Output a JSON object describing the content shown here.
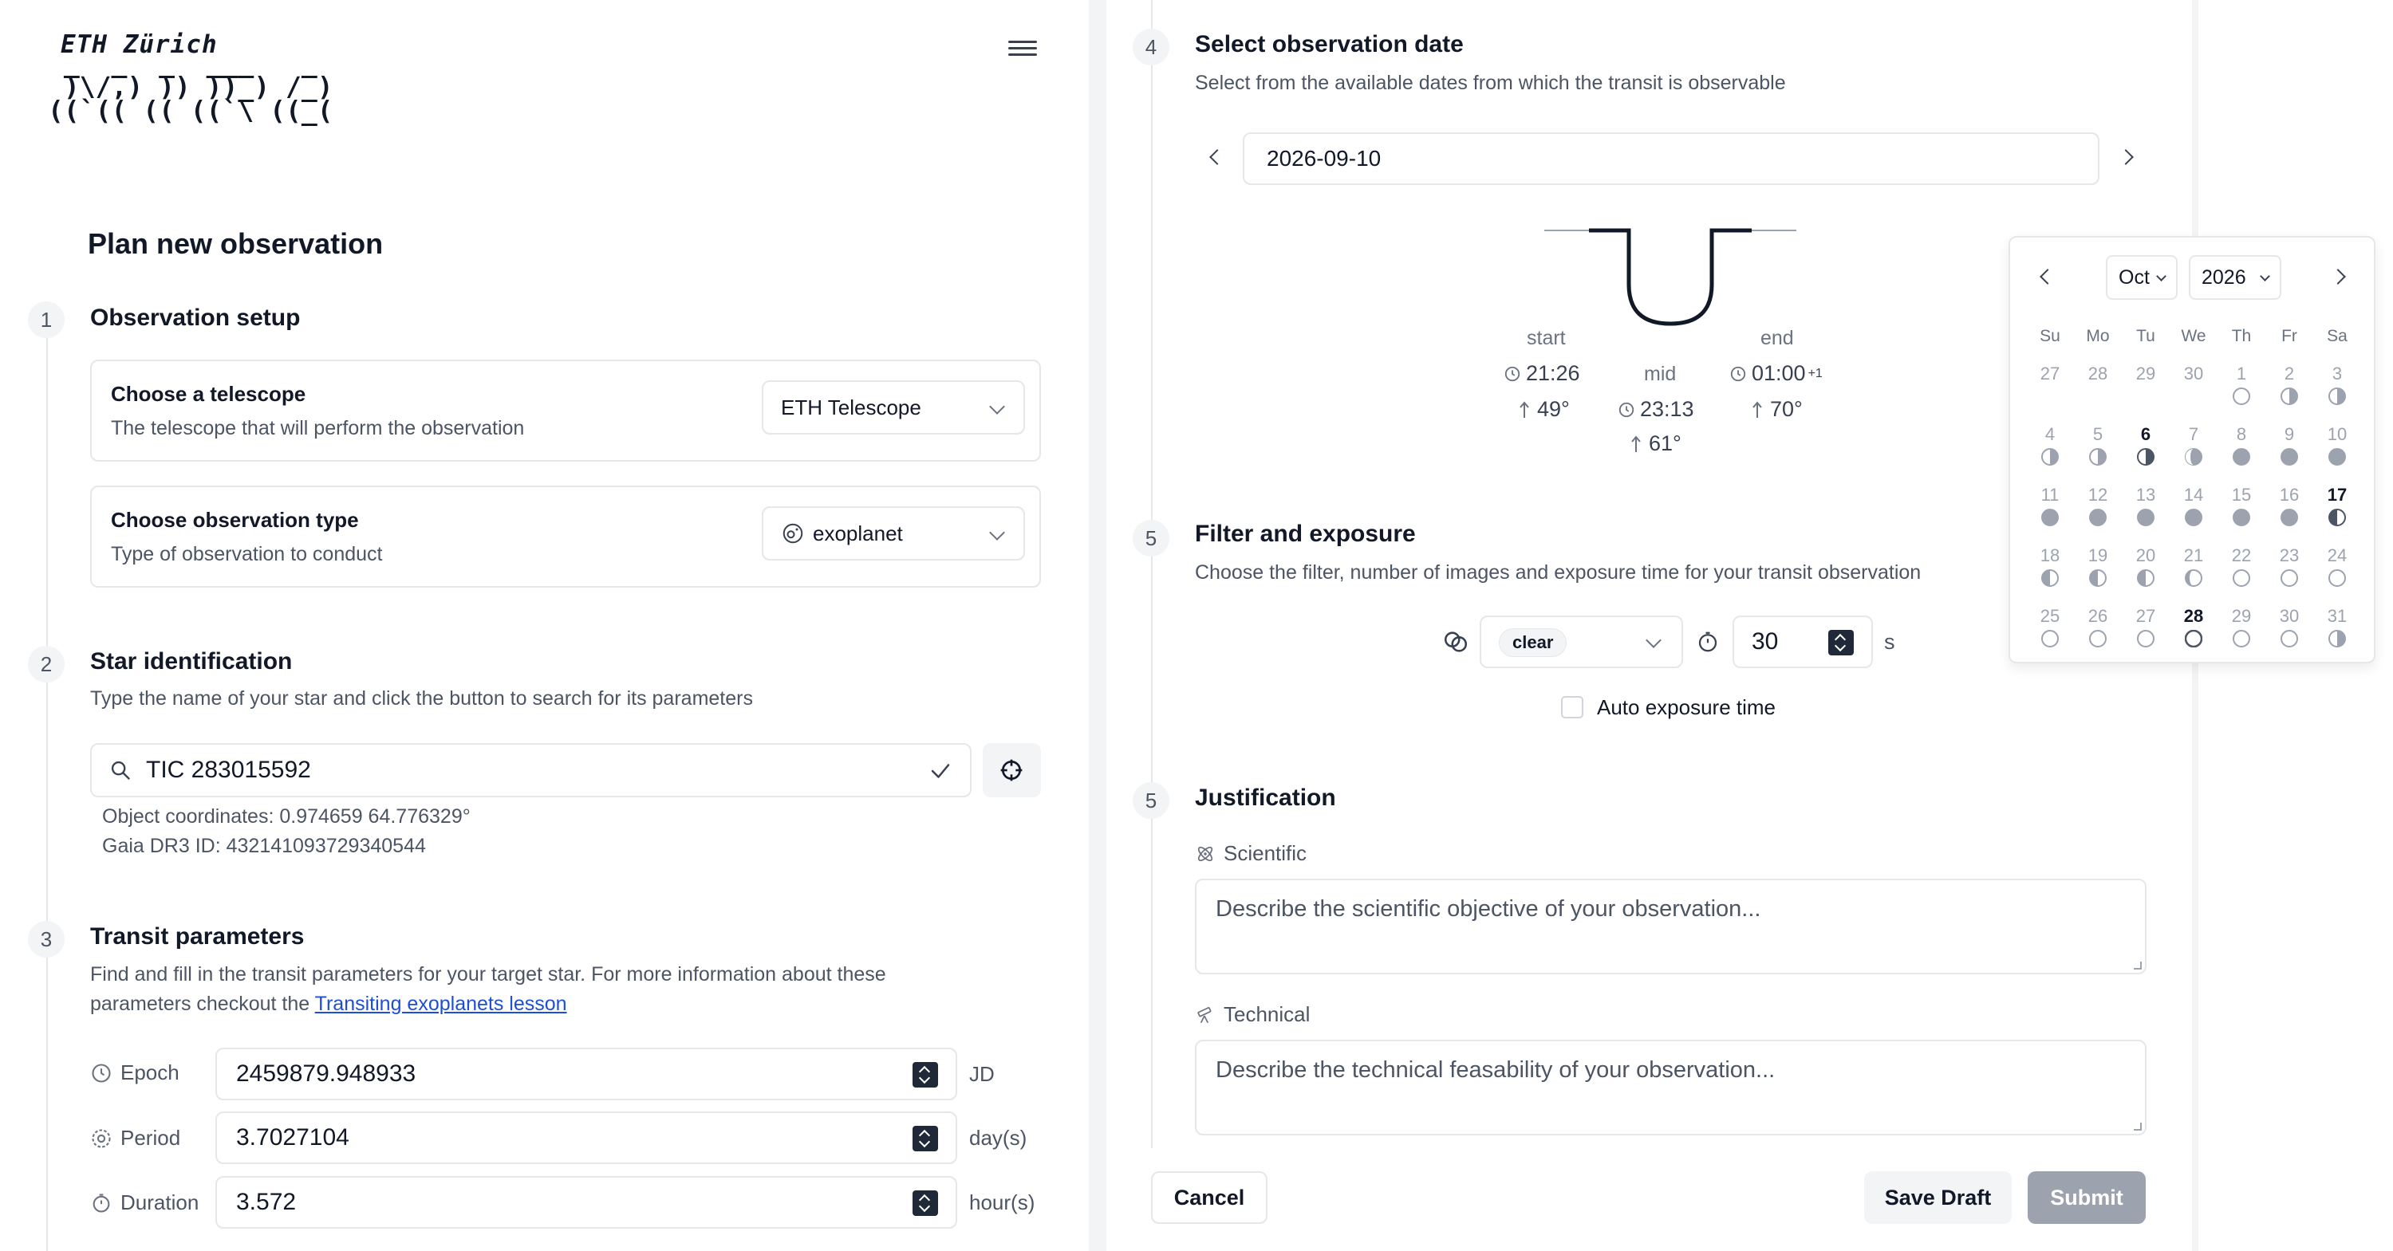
{
  "header": {
    "logo_title": "ETH Zürich",
    "logo_art_line1": " ̅)\\/̅,) ̅)) ̅)̅)̅_) /̅_)",
    "logo_art_line2": "((`(( (( ((`\\ ((_("
  },
  "page_title": "Plan new observation",
  "steps": {
    "s1": {
      "num": "1",
      "title": "Observation setup"
    },
    "s2": {
      "num": "2",
      "title": "Star identification",
      "desc": "Type the name of your star and click the button to search for its parameters"
    },
    "s3": {
      "num": "3",
      "title": "Transit parameters",
      "desc_part1": "Find and fill in the transit parameters for your target star. For more information about these",
      "desc_part2": "parameters checkout the ",
      "link": "Transiting exoplanets lesson"
    },
    "s4": {
      "num": "4",
      "title": "Select observation date",
      "desc": "Select from the available dates from which the transit is observable"
    },
    "s5": {
      "num": "5",
      "title": "Filter and exposure",
      "desc": "Choose the filter, number of images and exposure time for your transit observation"
    },
    "s6": {
      "num": "5",
      "title": "Justification"
    }
  },
  "telescope": {
    "title": "Choose a telescope",
    "desc": "The telescope that will perform the observation",
    "value": "ETH Telescope"
  },
  "obs_type": {
    "title": "Choose observation type",
    "desc": "Type of observation to conduct",
    "value": "exoplanet"
  },
  "star": {
    "value": "TIC 283015592",
    "coords": "Object coordinates: 0.974659 64.776329°",
    "gaia": "Gaia DR3 ID: 432141093729340544"
  },
  "params": [
    {
      "label": "Epoch",
      "value": "2459879.948933",
      "unit": "JD"
    },
    {
      "label": "Period",
      "value": "3.7027104",
      "unit": "day(s)"
    },
    {
      "label": "Duration",
      "value": "3.572",
      "unit": "hour(s)"
    }
  ],
  "date": {
    "value": "2026-09-10"
  },
  "transit": {
    "start_label": "start",
    "start_time": "21:26",
    "start_alt": "49°",
    "mid_label": "mid",
    "mid_time": "23:13",
    "mid_alt": "61°",
    "end_label": "end",
    "end_time": "01:00",
    "end_sup": "+1",
    "end_alt": "70°"
  },
  "filter": {
    "value": "clear"
  },
  "exposure": {
    "value": "30",
    "unit": "s",
    "auto_label": "Auto exposure time"
  },
  "justification": {
    "scientific_label": "Scientific",
    "scientific_placeholder": "Describe the scientific objective of your observation...",
    "technical_label": "Technical",
    "technical_placeholder": "Describe the technical feasability of your observation..."
  },
  "buttons": {
    "cancel": "Cancel",
    "save_draft": "Save Draft",
    "submit": "Submit"
  },
  "calendar": {
    "month": "Oct",
    "year": "2026",
    "weekdays": [
      "Su",
      "Mo",
      "Tu",
      "We",
      "Th",
      "Fr",
      "Sa"
    ],
    "weeks": [
      [
        {
          "d": "27",
          "cur": false,
          "moon": "none"
        },
        {
          "d": "28",
          "cur": false,
          "moon": "none"
        },
        {
          "d": "29",
          "cur": false,
          "moon": "none"
        },
        {
          "d": "30",
          "cur": false,
          "moon": "none"
        },
        {
          "d": "1",
          "cur": false,
          "moon": "new"
        },
        {
          "d": "2",
          "cur": false,
          "moon": "first"
        },
        {
          "d": "3",
          "cur": false,
          "moon": "first"
        }
      ],
      [
        {
          "d": "4",
          "cur": false,
          "moon": "first"
        },
        {
          "d": "5",
          "cur": false,
          "moon": "first"
        },
        {
          "d": "6",
          "cur": true,
          "moon": "first-dark"
        },
        {
          "d": "7",
          "cur": false,
          "moon": "gibbous"
        },
        {
          "d": "8",
          "cur": false,
          "moon": "full"
        },
        {
          "d": "9",
          "cur": false,
          "moon": "full"
        },
        {
          "d": "10",
          "cur": false,
          "moon": "full"
        }
      ],
      [
        {
          "d": "11",
          "cur": false,
          "moon": "full"
        },
        {
          "d": "12",
          "cur": false,
          "moon": "full"
        },
        {
          "d": "13",
          "cur": false,
          "moon": "full"
        },
        {
          "d": "14",
          "cur": false,
          "moon": "full"
        },
        {
          "d": "15",
          "cur": false,
          "moon": "full"
        },
        {
          "d": "16",
          "cur": false,
          "moon": "full"
        },
        {
          "d": "17",
          "cur": true,
          "moon": "last-dark"
        }
      ],
      [
        {
          "d": "18",
          "cur": false,
          "moon": "last"
        },
        {
          "d": "19",
          "cur": false,
          "moon": "last"
        },
        {
          "d": "20",
          "cur": false,
          "moon": "last"
        },
        {
          "d": "21",
          "cur": false,
          "moon": "crescent"
        },
        {
          "d": "22",
          "cur": false,
          "moon": "new"
        },
        {
          "d": "23",
          "cur": false,
          "moon": "new"
        },
        {
          "d": "24",
          "cur": false,
          "moon": "new"
        }
      ],
      [
        {
          "d": "25",
          "cur": false,
          "moon": "new"
        },
        {
          "d": "26",
          "cur": false,
          "moon": "new"
        },
        {
          "d": "27",
          "cur": false,
          "moon": "new"
        },
        {
          "d": "28",
          "cur": true,
          "moon": "new-dark"
        },
        {
          "d": "29",
          "cur": false,
          "moon": "new"
        },
        {
          "d": "30",
          "cur": false,
          "moon": "new"
        },
        {
          "d": "31",
          "cur": false,
          "moon": "first"
        }
      ]
    ]
  },
  "icons": {
    "menu": "hamburger-menu-icon",
    "search": "search-icon",
    "check": "check-icon",
    "target": "crosshair-icon",
    "clock": "clock-icon",
    "period": "cycle-icon",
    "timer": "timer-icon",
    "arrow_up": "arrow-up-icon",
    "filter": "filter-circles-icon",
    "scientific": "atom-icon",
    "technical": "telescope-icon"
  },
  "colors": {
    "accent_link": "#1d4ed8",
    "submit_disabled": "#9ca3af",
    "moon_shade": "#9ca3af",
    "moon_dark": "#4b5563"
  }
}
